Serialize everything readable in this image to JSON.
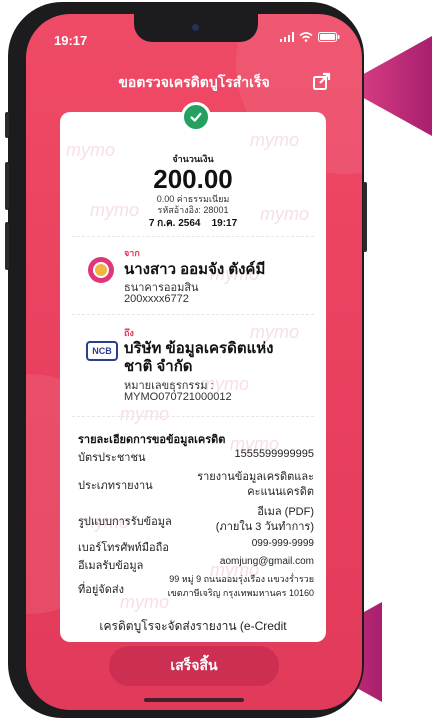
{
  "status_bar": {
    "time": "19:17"
  },
  "header": {
    "title": "ขอตรวจเครดิตบูโรสำเร็จ"
  },
  "receipt": {
    "watermark": "mymo",
    "amount_label": "จำนวนเงิน",
    "amount": "200.00",
    "fee": "0.00 ค่าธรรมเนียม",
    "reference": "รหัสอ้างอิง: 28001",
    "datetime": "7 ก.ค. 2564    19:17",
    "from": {
      "tag": "จาก",
      "name": "นางสาว ออมจัง ตังค์มี",
      "bank": "ธนาคารออมสิน",
      "account": "200xxxx6772"
    },
    "to": {
      "tag": "ถึง",
      "logo_text": "NCB",
      "name_line1": "บริษัท ข้อมูลเครดิตแห่ง",
      "name_line2": "ชาติ จำกัด",
      "ref_label": "หมายเลขธุรกรรม :",
      "ref_value": "MYMO070721000012"
    },
    "details": {
      "title": "รายละเอียดการขอข้อมูลเครดิต",
      "rows": [
        {
          "label": "บัตรประชาชน",
          "value": "1555599999995"
        },
        {
          "label": "ประเภทรายงาน",
          "value_line1": "รายงานข้อมูลเครดิตและ",
          "value_line2": "คะแนนเครดิต"
        },
        {
          "label": "รูปแบบการรับข้อมูล",
          "value_line1": "อีเมล (PDF)",
          "value_line2": "(ภายใน 3 วันทำการ)"
        },
        {
          "label": "เบอร์โทรศัพท์มือถือ",
          "value": "099-999-9999"
        },
        {
          "label": "อีเมลรับข้อมูล",
          "value": "aomjung@gmail.com"
        },
        {
          "label": "ที่อยู่จัดส่ง",
          "value_line1": "99 หมู่ 9 ถนนออมรุ่งเรือง แขวงร่ำรวย",
          "value_line2": "เขตภาษีเจริญ กรุงเทพมหานคร 10160"
        }
      ]
    },
    "note": "เครดิตบูโรจะจัดส่งรายงาน (e-Credit"
  },
  "footer": {
    "done_label": "เสร็จสิ้น"
  },
  "colors": {
    "accent": "#e8405e",
    "button": "#cc2f52",
    "success": "#25a060",
    "arrow": "#c7247a"
  }
}
